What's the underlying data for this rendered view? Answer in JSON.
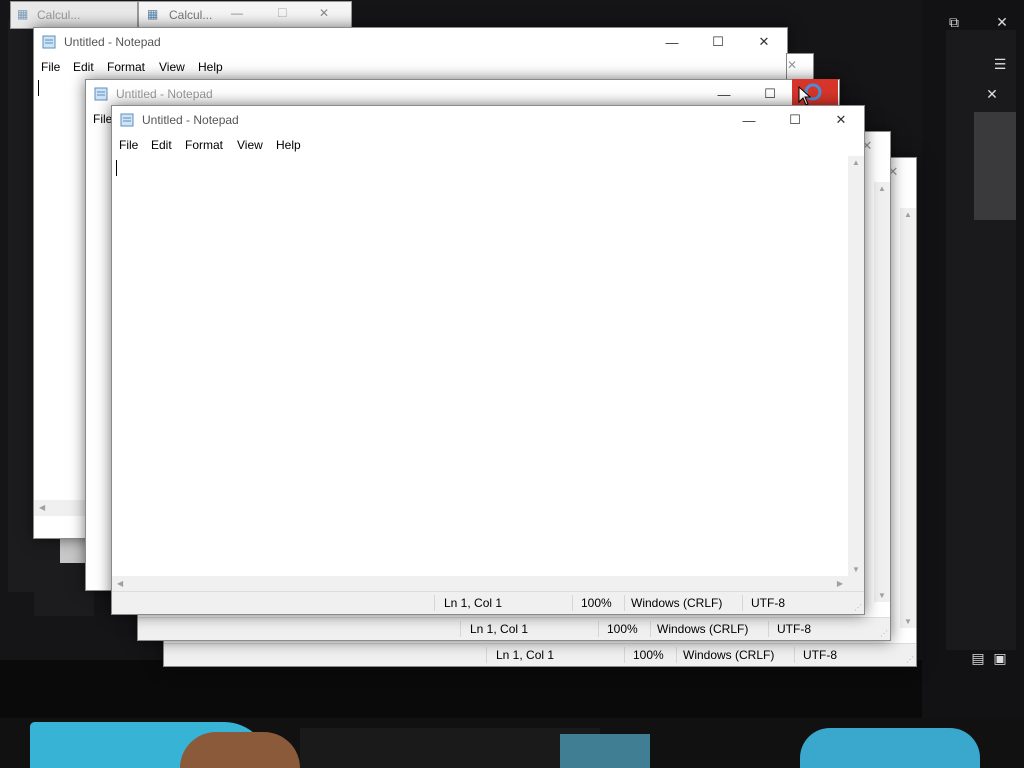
{
  "background": {
    "accent": "#0a0a0b"
  },
  "calculator": {
    "title": "Calcul...",
    "title_back": "Calcul..."
  },
  "notepad": {
    "title": "Untitled - Notepad",
    "menus": [
      "File",
      "Edit",
      "Format",
      "View",
      "Help"
    ],
    "status": {
      "position": "Ln 1, Col 1",
      "zoom": "100%",
      "line_ending": "Windows (CRLF)",
      "encoding": "UTF-8"
    }
  },
  "icons": {
    "minimize": "minimize-icon",
    "maximize": "maximize-icon",
    "close": "close-icon",
    "notepad": "notepad-icon",
    "calculator": "calculator-icon",
    "restore": "restore-icon",
    "hamburger": "hamburger-menu-icon",
    "layout": "layout-icon"
  },
  "colors": {
    "close_hover": "#d8352a",
    "window_bg": "#ffffff",
    "status_bg": "#f0f0f0"
  }
}
